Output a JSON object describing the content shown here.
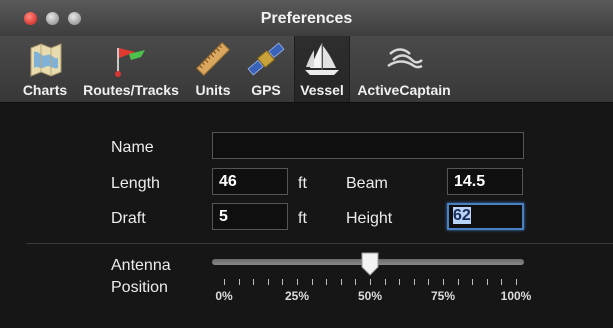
{
  "window": {
    "title": "Preferences"
  },
  "toolbar": {
    "items": [
      {
        "label": "Charts",
        "icon": "chart-map-icon"
      },
      {
        "label": "Routes/Tracks",
        "icon": "route-flag-icon"
      },
      {
        "label": "Units",
        "icon": "ruler-icon"
      },
      {
        "label": "GPS",
        "icon": "satellite-icon"
      },
      {
        "label": "Vessel",
        "icon": "sailboat-icon",
        "selected": true
      },
      {
        "label": "ActiveCaptain",
        "icon": "activecaptain-wave-icon"
      }
    ]
  },
  "vessel": {
    "name": {
      "label": "Name",
      "value": ""
    },
    "length": {
      "label": "Length",
      "value": "46",
      "unit": "ft"
    },
    "beam": {
      "label": "Beam",
      "value": "14.5"
    },
    "draft": {
      "label": "Draft",
      "value": "5",
      "unit": "ft"
    },
    "height": {
      "label": "Height",
      "value": "62"
    },
    "antenna": {
      "label_line1": "Antenna",
      "label_line2": "Position",
      "value_percent": 50,
      "ticks": [
        "0%",
        "25%",
        "50%",
        "75%",
        "100%"
      ]
    }
  },
  "colors": {
    "focus": "#4a7fc0",
    "close": "#e0443e"
  }
}
